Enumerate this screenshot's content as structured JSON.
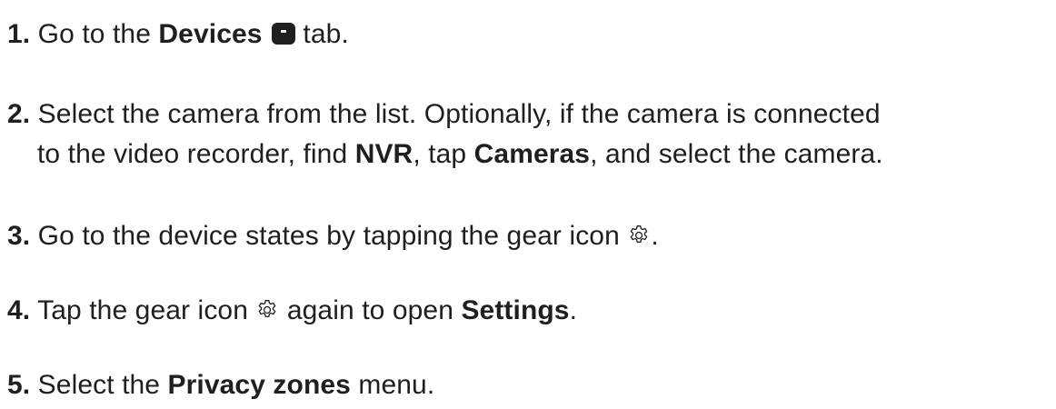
{
  "steps": [
    {
      "number": "1.",
      "parts": {
        "t1": " Go to the ",
        "b1": "Devices",
        "t2": " tab."
      }
    },
    {
      "number": "2.",
      "line1": " Select the camera from the list. Optionally, if the camera is connected",
      "line2": {
        "t1": "to the video recorder, find ",
        "b1": "NVR",
        "t2": ", tap ",
        "b2": "Cameras",
        "t3": ", and select the camera."
      }
    },
    {
      "number": "3.",
      "parts": {
        "t1": " Go to the device states by tapping the gear icon ",
        "t2": "."
      }
    },
    {
      "number": "4.",
      "parts": {
        "t1": " Tap the gear icon ",
        "t2": " again to open ",
        "b1": "Settings",
        "t3": "."
      }
    },
    {
      "number": "5.",
      "parts": {
        "t1": " Select the ",
        "b1": "Privacy zones",
        "t2": " menu."
      }
    }
  ],
  "icons": {
    "devices": "devices-tab-icon",
    "gear": "gear-icon"
  },
  "colors": {
    "text": "#1f1f1f",
    "background": "#ffffff"
  }
}
